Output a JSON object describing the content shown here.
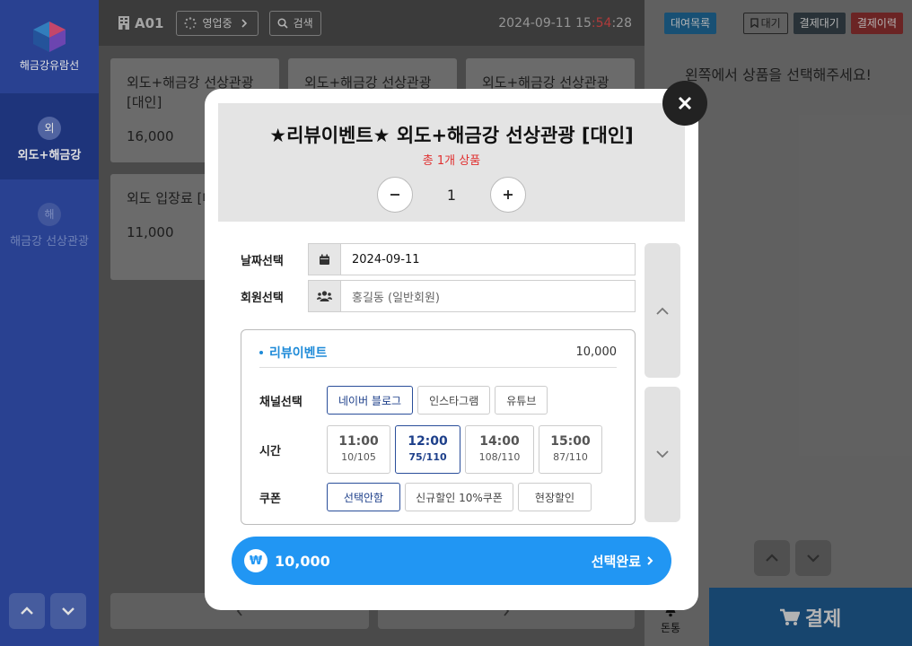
{
  "sidebar": {
    "brand": "해금강유람선",
    "items": [
      {
        "icon_char": "외",
        "label": "외도+해금강",
        "active": true
      },
      {
        "icon_char": "해",
        "label": "해금강 선상관광",
        "active": false
      }
    ]
  },
  "topbar": {
    "store_code": "A01",
    "status_label": "영업중",
    "search_label": "검색",
    "datetime": {
      "date": "2024-09-11",
      "hour": "15",
      "sep1": ":",
      "min": "54",
      "sep2": ":",
      "sec": "28"
    }
  },
  "products": [
    {
      "name": "외도+해금강 선상관광 [대인]",
      "price": "16,000"
    },
    {
      "name": "외도+해금강 선상관광",
      "price": ""
    },
    {
      "name": "외도+해금강 선상관광",
      "price": ""
    },
    {
      "name": "외도 입장료 [대인]",
      "price": "11,000"
    }
  ],
  "right_panel": {
    "buttons": {
      "rental_list": "대여목록",
      "wait": "대기",
      "pay_wait": "결제대기",
      "pay_history": "결제이력"
    },
    "empty_message": "왼쪽에서 상품을 선택해주세요!",
    "bell_label": "돈통",
    "pay_label": "결제"
  },
  "modal": {
    "title": "★리뷰이벤트★ 외도+해금강 선상관광 [대인]",
    "subtitle": "총 1개 상품",
    "quantity": "1",
    "date_label": "날짜선택",
    "date_value": "2024-09-11",
    "member_label": "회원선택",
    "member_value": "홍길동 (일반회원)",
    "option": {
      "name": "리뷰이벤트",
      "price": "10,000",
      "channel_label": "채널선택",
      "channels": [
        {
          "label": "네이버 블로그",
          "selected": true
        },
        {
          "label": "인스타그램",
          "selected": false
        },
        {
          "label": "유튜브",
          "selected": false
        }
      ],
      "time_label": "시간",
      "times": [
        {
          "time": "11:00",
          "count": "10/105",
          "selected": false
        },
        {
          "time": "12:00",
          "count": "75/110",
          "selected": true
        },
        {
          "time": "14:00",
          "count": "108/110",
          "selected": false
        },
        {
          "time": "15:00",
          "count": "87/110",
          "selected": false
        }
      ],
      "coupon_label": "쿠폰",
      "coupons": [
        {
          "label": "선택안함",
          "selected": true
        },
        {
          "label": "신규할인 10%쿠폰",
          "selected": false
        },
        {
          "label": "현장할인",
          "selected": false
        }
      ]
    },
    "currency_symbol": "₩",
    "total": "10,000",
    "confirm_label": "선택완료"
  },
  "colors": {
    "accent_blue": "#2196f3",
    "sidebar_blue": "#2f4ba6",
    "selected_navy": "#1d3f8a",
    "count_red": "#e03030"
  },
  "icons": [
    "building-icon",
    "spinner-icon",
    "chevron-right-icon",
    "search-icon",
    "bookmark-icon",
    "close-icon",
    "minus-icon",
    "plus-icon",
    "calendar-icon",
    "users-icon",
    "chevron-up-icon",
    "chevron-down-icon",
    "won-icon",
    "bell-icon",
    "cart-icon"
  ]
}
